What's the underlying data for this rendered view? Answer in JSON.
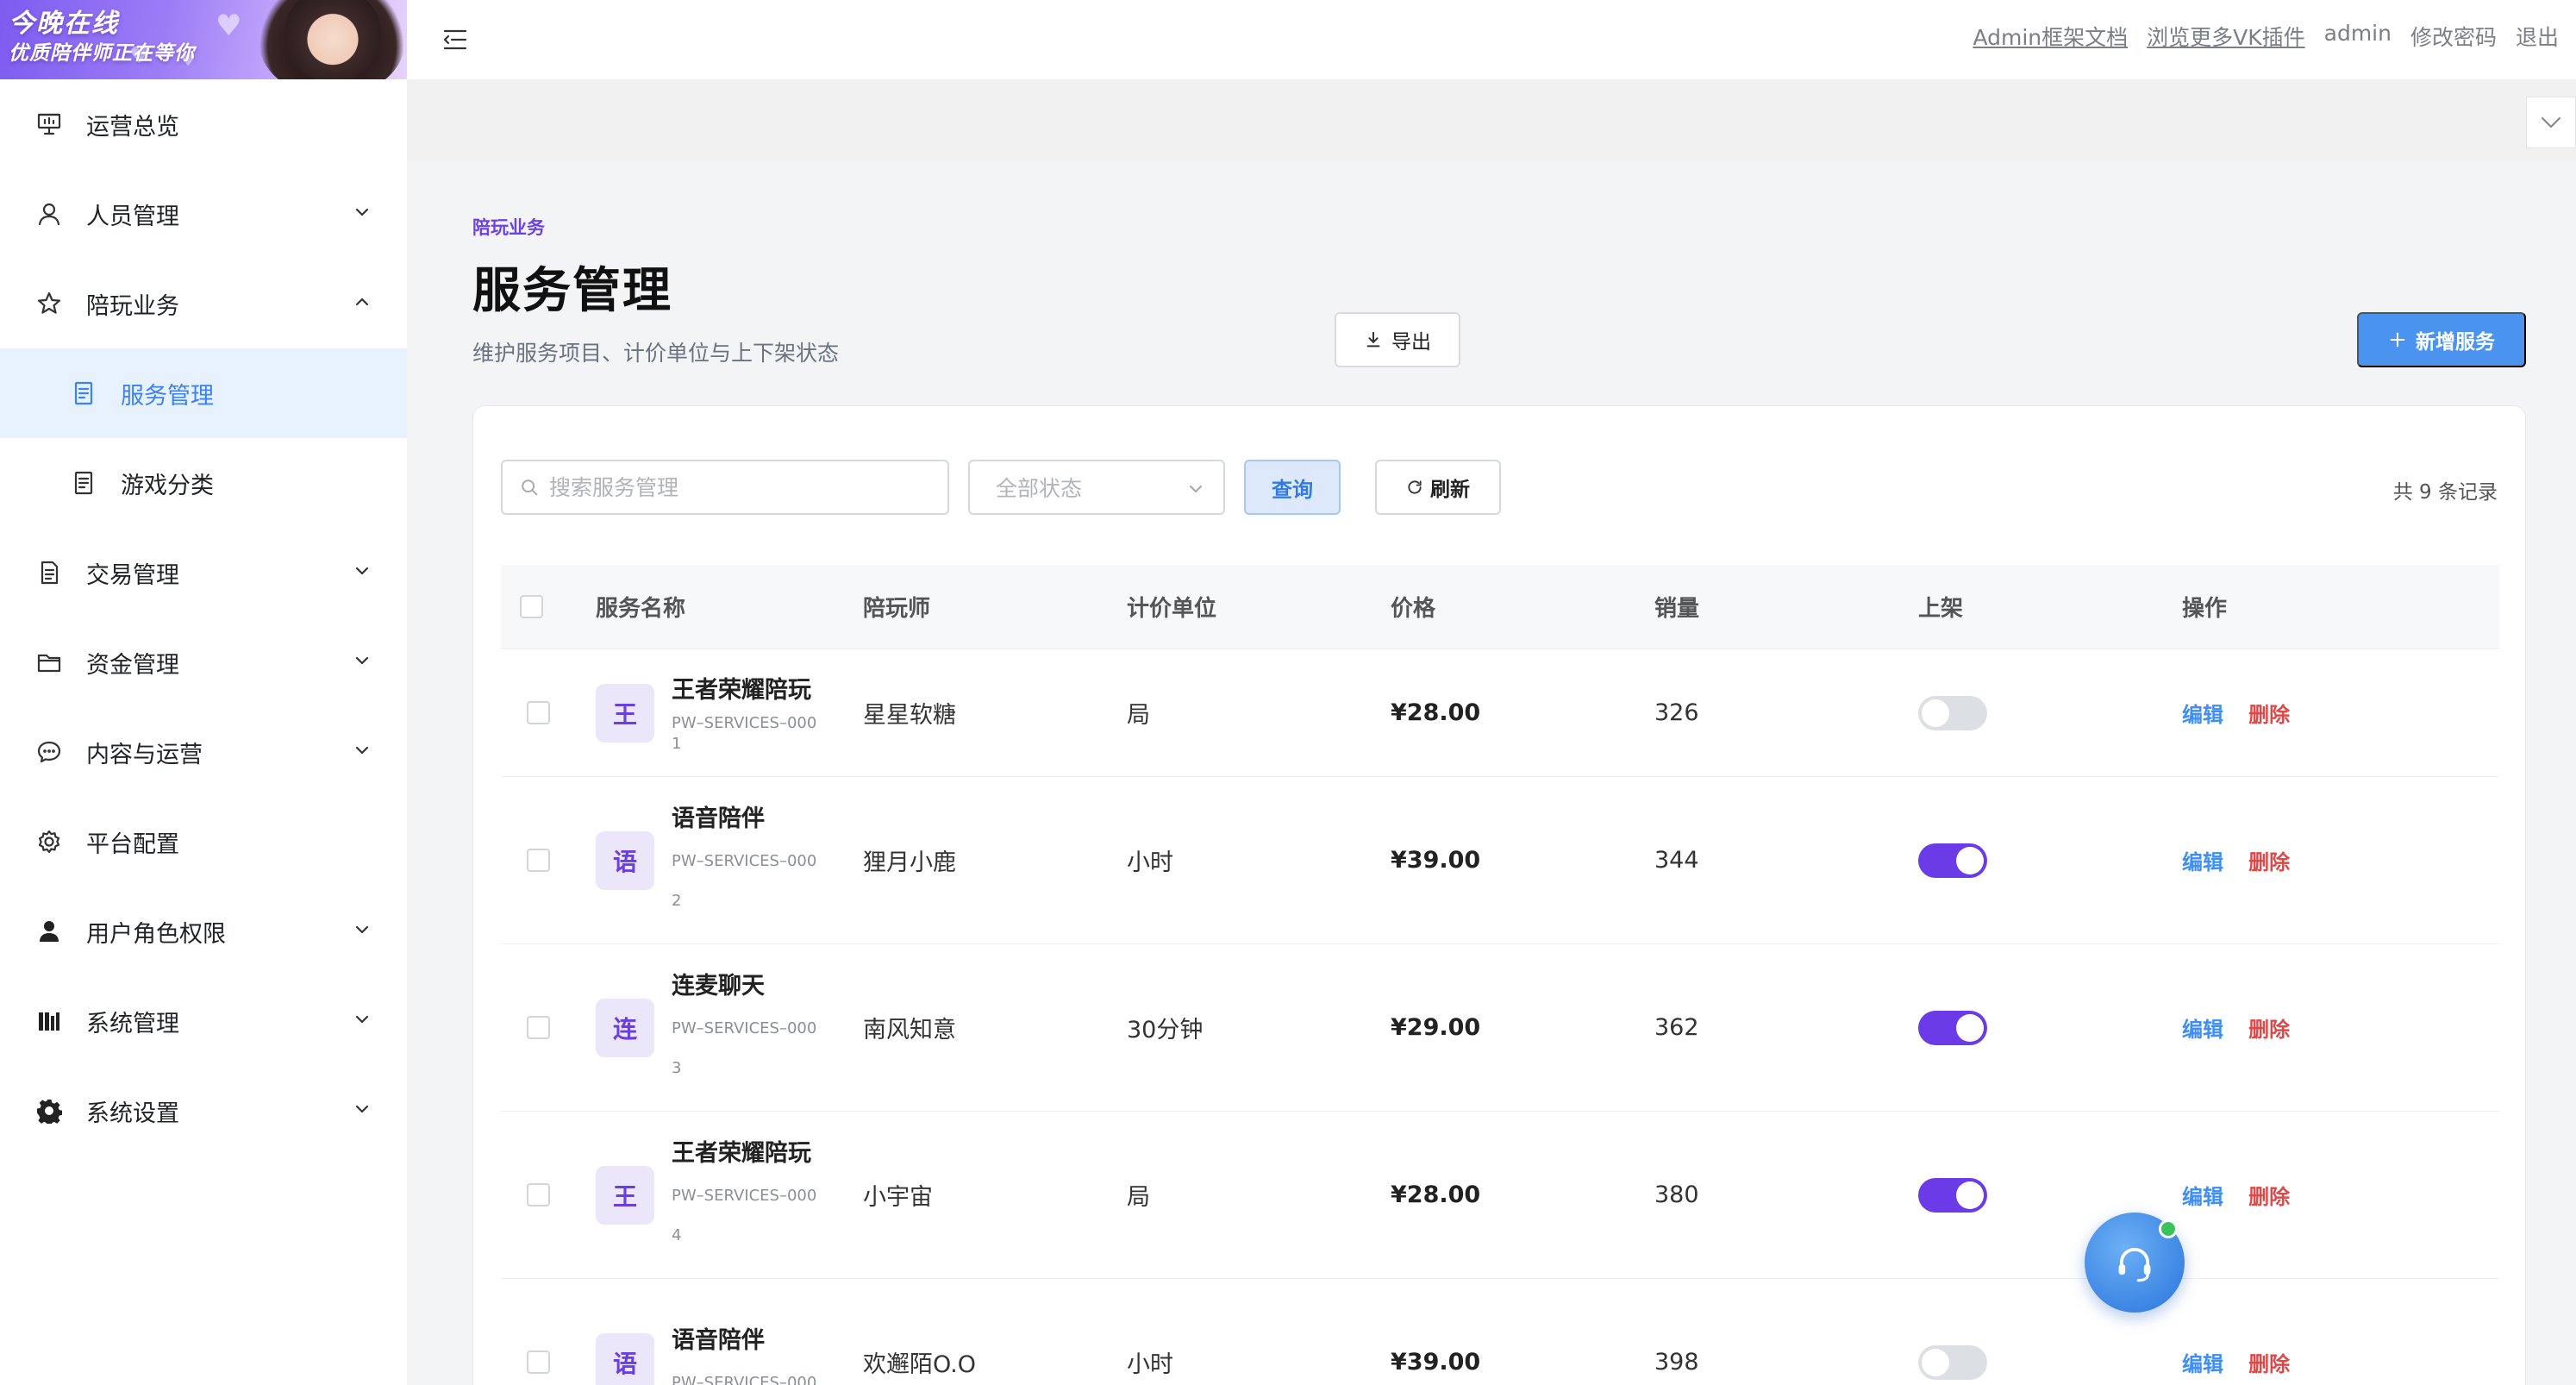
{
  "banner": {
    "line1": "今晚在线",
    "line2": "优质陪伴师正在等你"
  },
  "sidebar": {
    "items": [
      {
        "label": "运营总览",
        "icon": "dashboard-board-icon",
        "chevron": ""
      },
      {
        "label": "人员管理",
        "icon": "user-icon",
        "chevron": "down"
      },
      {
        "label": "陪玩业务",
        "icon": "star-icon",
        "chevron": "up"
      },
      {
        "label": "服务管理",
        "icon": "document-icon",
        "chevron": "",
        "sub": true,
        "active": true
      },
      {
        "label": "游戏分类",
        "icon": "document-icon",
        "chevron": "",
        "sub": true
      },
      {
        "label": "交易管理",
        "icon": "document-icon",
        "chevron": "down"
      },
      {
        "label": "资金管理",
        "icon": "folder-icon",
        "chevron": "down"
      },
      {
        "label": "内容与运营",
        "icon": "chat-icon",
        "chevron": "down"
      },
      {
        "label": "平台配置",
        "icon": "gear-outline-icon",
        "chevron": ""
      },
      {
        "label": "用户角色权限",
        "icon": "person-filled-icon",
        "chevron": "down"
      },
      {
        "label": "系统管理",
        "icon": "bars-chart-icon",
        "chevron": "down"
      },
      {
        "label": "系统设置",
        "icon": "gear-filled-icon",
        "chevron": "down"
      }
    ]
  },
  "header": {
    "links": [
      {
        "label": "Admin框架文档",
        "link": true
      },
      {
        "label": "浏览更多VK插件",
        "link": true
      },
      {
        "label": "admin",
        "link": false
      },
      {
        "label": "修改密码",
        "link": false
      },
      {
        "label": "退出",
        "link": false
      }
    ]
  },
  "page": {
    "breadcrumb": "陪玩业务",
    "title": "服务管理",
    "description": "维护服务项目、计价单位与上下架状态",
    "export_label": "导出",
    "add_label": "新增服务"
  },
  "filters": {
    "search_placeholder": "搜索服务管理",
    "status_placeholder": "全部状态",
    "query_label": "查询",
    "refresh_label": "刷新",
    "total_text": "共 9 条记录"
  },
  "table": {
    "headers": [
      "服务名称",
      "陪玩师",
      "计价单位",
      "价格",
      "销量",
      "上架",
      "操作"
    ],
    "edit_label": "编辑",
    "delete_label": "删除",
    "rows": [
      {
        "avatar": "王",
        "name": "王者荣耀陪玩",
        "code": "PW–SERVICES–0001",
        "companion": "星星软糖",
        "unit": "局",
        "price": "¥28.00",
        "sales": "326",
        "on_shelf": false
      },
      {
        "avatar": "语",
        "name": "语音陪伴",
        "code": "PW–SERVICES–0002",
        "companion": "狸月小鹿",
        "unit": "小时",
        "price": "¥39.00",
        "sales": "344",
        "on_shelf": true
      },
      {
        "avatar": "连",
        "name": "连麦聊天",
        "code": "PW–SERVICES–0003",
        "companion": "南风知意",
        "unit": "30分钟",
        "price": "¥29.00",
        "sales": "362",
        "on_shelf": true
      },
      {
        "avatar": "王",
        "name": "王者荣耀陪玩",
        "code": "PW–SERVICES–0004",
        "companion": "小宇宙",
        "unit": "局",
        "price": "¥28.00",
        "sales": "380",
        "on_shelf": true
      },
      {
        "avatar": "语",
        "name": "语音陪伴",
        "code": "PW–SERVICES–000",
        "companion": "欢邂陌O.O",
        "unit": "小时",
        "price": "¥39.00",
        "sales": "398",
        "on_shelf": false
      }
    ]
  },
  "colors": {
    "accent": "#3b82f6",
    "brand_purple": "#6a3be6",
    "danger": "#e04848"
  }
}
